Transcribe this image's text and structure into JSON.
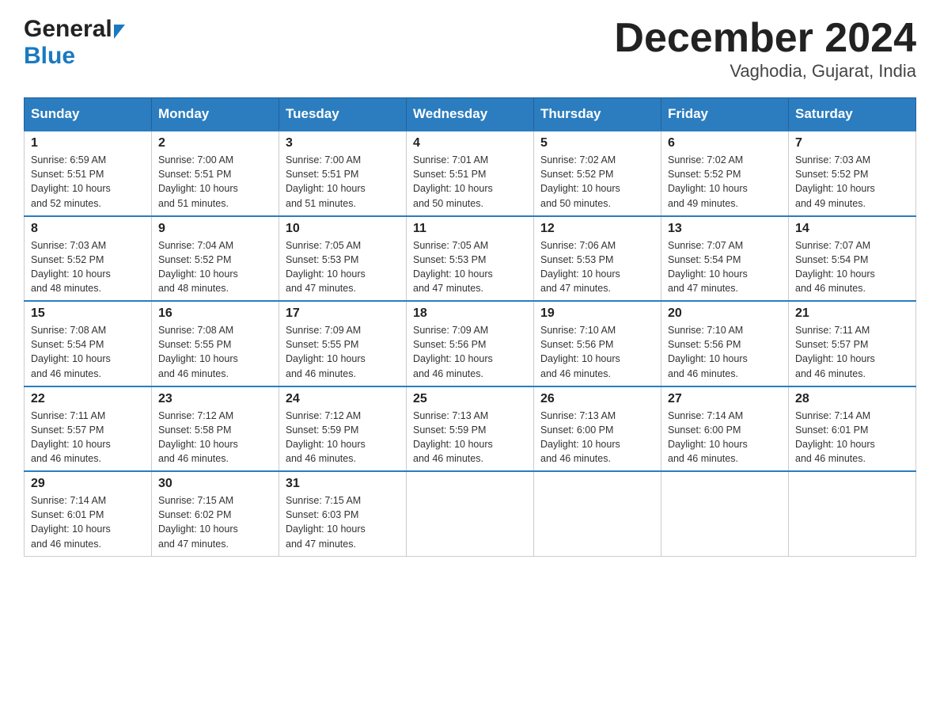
{
  "header": {
    "logo_general": "General",
    "logo_blue": "Blue",
    "title": "December 2024",
    "subtitle": "Vaghodia, Gujarat, India"
  },
  "weekdays": [
    "Sunday",
    "Monday",
    "Tuesday",
    "Wednesday",
    "Thursday",
    "Friday",
    "Saturday"
  ],
  "weeks": [
    [
      {
        "day": "1",
        "sunrise": "6:59 AM",
        "sunset": "5:51 PM",
        "daylight": "10 hours and 52 minutes."
      },
      {
        "day": "2",
        "sunrise": "7:00 AM",
        "sunset": "5:51 PM",
        "daylight": "10 hours and 51 minutes."
      },
      {
        "day": "3",
        "sunrise": "7:00 AM",
        "sunset": "5:51 PM",
        "daylight": "10 hours and 51 minutes."
      },
      {
        "day": "4",
        "sunrise": "7:01 AM",
        "sunset": "5:51 PM",
        "daylight": "10 hours and 50 minutes."
      },
      {
        "day": "5",
        "sunrise": "7:02 AM",
        "sunset": "5:52 PM",
        "daylight": "10 hours and 50 minutes."
      },
      {
        "day": "6",
        "sunrise": "7:02 AM",
        "sunset": "5:52 PM",
        "daylight": "10 hours and 49 minutes."
      },
      {
        "day": "7",
        "sunrise": "7:03 AM",
        "sunset": "5:52 PM",
        "daylight": "10 hours and 49 minutes."
      }
    ],
    [
      {
        "day": "8",
        "sunrise": "7:03 AM",
        "sunset": "5:52 PM",
        "daylight": "10 hours and 48 minutes."
      },
      {
        "day": "9",
        "sunrise": "7:04 AM",
        "sunset": "5:52 PM",
        "daylight": "10 hours and 48 minutes."
      },
      {
        "day": "10",
        "sunrise": "7:05 AM",
        "sunset": "5:53 PM",
        "daylight": "10 hours and 47 minutes."
      },
      {
        "day": "11",
        "sunrise": "7:05 AM",
        "sunset": "5:53 PM",
        "daylight": "10 hours and 47 minutes."
      },
      {
        "day": "12",
        "sunrise": "7:06 AM",
        "sunset": "5:53 PM",
        "daylight": "10 hours and 47 minutes."
      },
      {
        "day": "13",
        "sunrise": "7:07 AM",
        "sunset": "5:54 PM",
        "daylight": "10 hours and 47 minutes."
      },
      {
        "day": "14",
        "sunrise": "7:07 AM",
        "sunset": "5:54 PM",
        "daylight": "10 hours and 46 minutes."
      }
    ],
    [
      {
        "day": "15",
        "sunrise": "7:08 AM",
        "sunset": "5:54 PM",
        "daylight": "10 hours and 46 minutes."
      },
      {
        "day": "16",
        "sunrise": "7:08 AM",
        "sunset": "5:55 PM",
        "daylight": "10 hours and 46 minutes."
      },
      {
        "day": "17",
        "sunrise": "7:09 AM",
        "sunset": "5:55 PM",
        "daylight": "10 hours and 46 minutes."
      },
      {
        "day": "18",
        "sunrise": "7:09 AM",
        "sunset": "5:56 PM",
        "daylight": "10 hours and 46 minutes."
      },
      {
        "day": "19",
        "sunrise": "7:10 AM",
        "sunset": "5:56 PM",
        "daylight": "10 hours and 46 minutes."
      },
      {
        "day": "20",
        "sunrise": "7:10 AM",
        "sunset": "5:56 PM",
        "daylight": "10 hours and 46 minutes."
      },
      {
        "day": "21",
        "sunrise": "7:11 AM",
        "sunset": "5:57 PM",
        "daylight": "10 hours and 46 minutes."
      }
    ],
    [
      {
        "day": "22",
        "sunrise": "7:11 AM",
        "sunset": "5:57 PM",
        "daylight": "10 hours and 46 minutes."
      },
      {
        "day": "23",
        "sunrise": "7:12 AM",
        "sunset": "5:58 PM",
        "daylight": "10 hours and 46 minutes."
      },
      {
        "day": "24",
        "sunrise": "7:12 AM",
        "sunset": "5:59 PM",
        "daylight": "10 hours and 46 minutes."
      },
      {
        "day": "25",
        "sunrise": "7:13 AM",
        "sunset": "5:59 PM",
        "daylight": "10 hours and 46 minutes."
      },
      {
        "day": "26",
        "sunrise": "7:13 AM",
        "sunset": "6:00 PM",
        "daylight": "10 hours and 46 minutes."
      },
      {
        "day": "27",
        "sunrise": "7:14 AM",
        "sunset": "6:00 PM",
        "daylight": "10 hours and 46 minutes."
      },
      {
        "day": "28",
        "sunrise": "7:14 AM",
        "sunset": "6:01 PM",
        "daylight": "10 hours and 46 minutes."
      }
    ],
    [
      {
        "day": "29",
        "sunrise": "7:14 AM",
        "sunset": "6:01 PM",
        "daylight": "10 hours and 46 minutes."
      },
      {
        "day": "30",
        "sunrise": "7:15 AM",
        "sunset": "6:02 PM",
        "daylight": "10 hours and 47 minutes."
      },
      {
        "day": "31",
        "sunrise": "7:15 AM",
        "sunset": "6:03 PM",
        "daylight": "10 hours and 47 minutes."
      },
      null,
      null,
      null,
      null
    ]
  ],
  "sunrise_label": "Sunrise:",
  "sunset_label": "Sunset:",
  "daylight_label": "Daylight:"
}
